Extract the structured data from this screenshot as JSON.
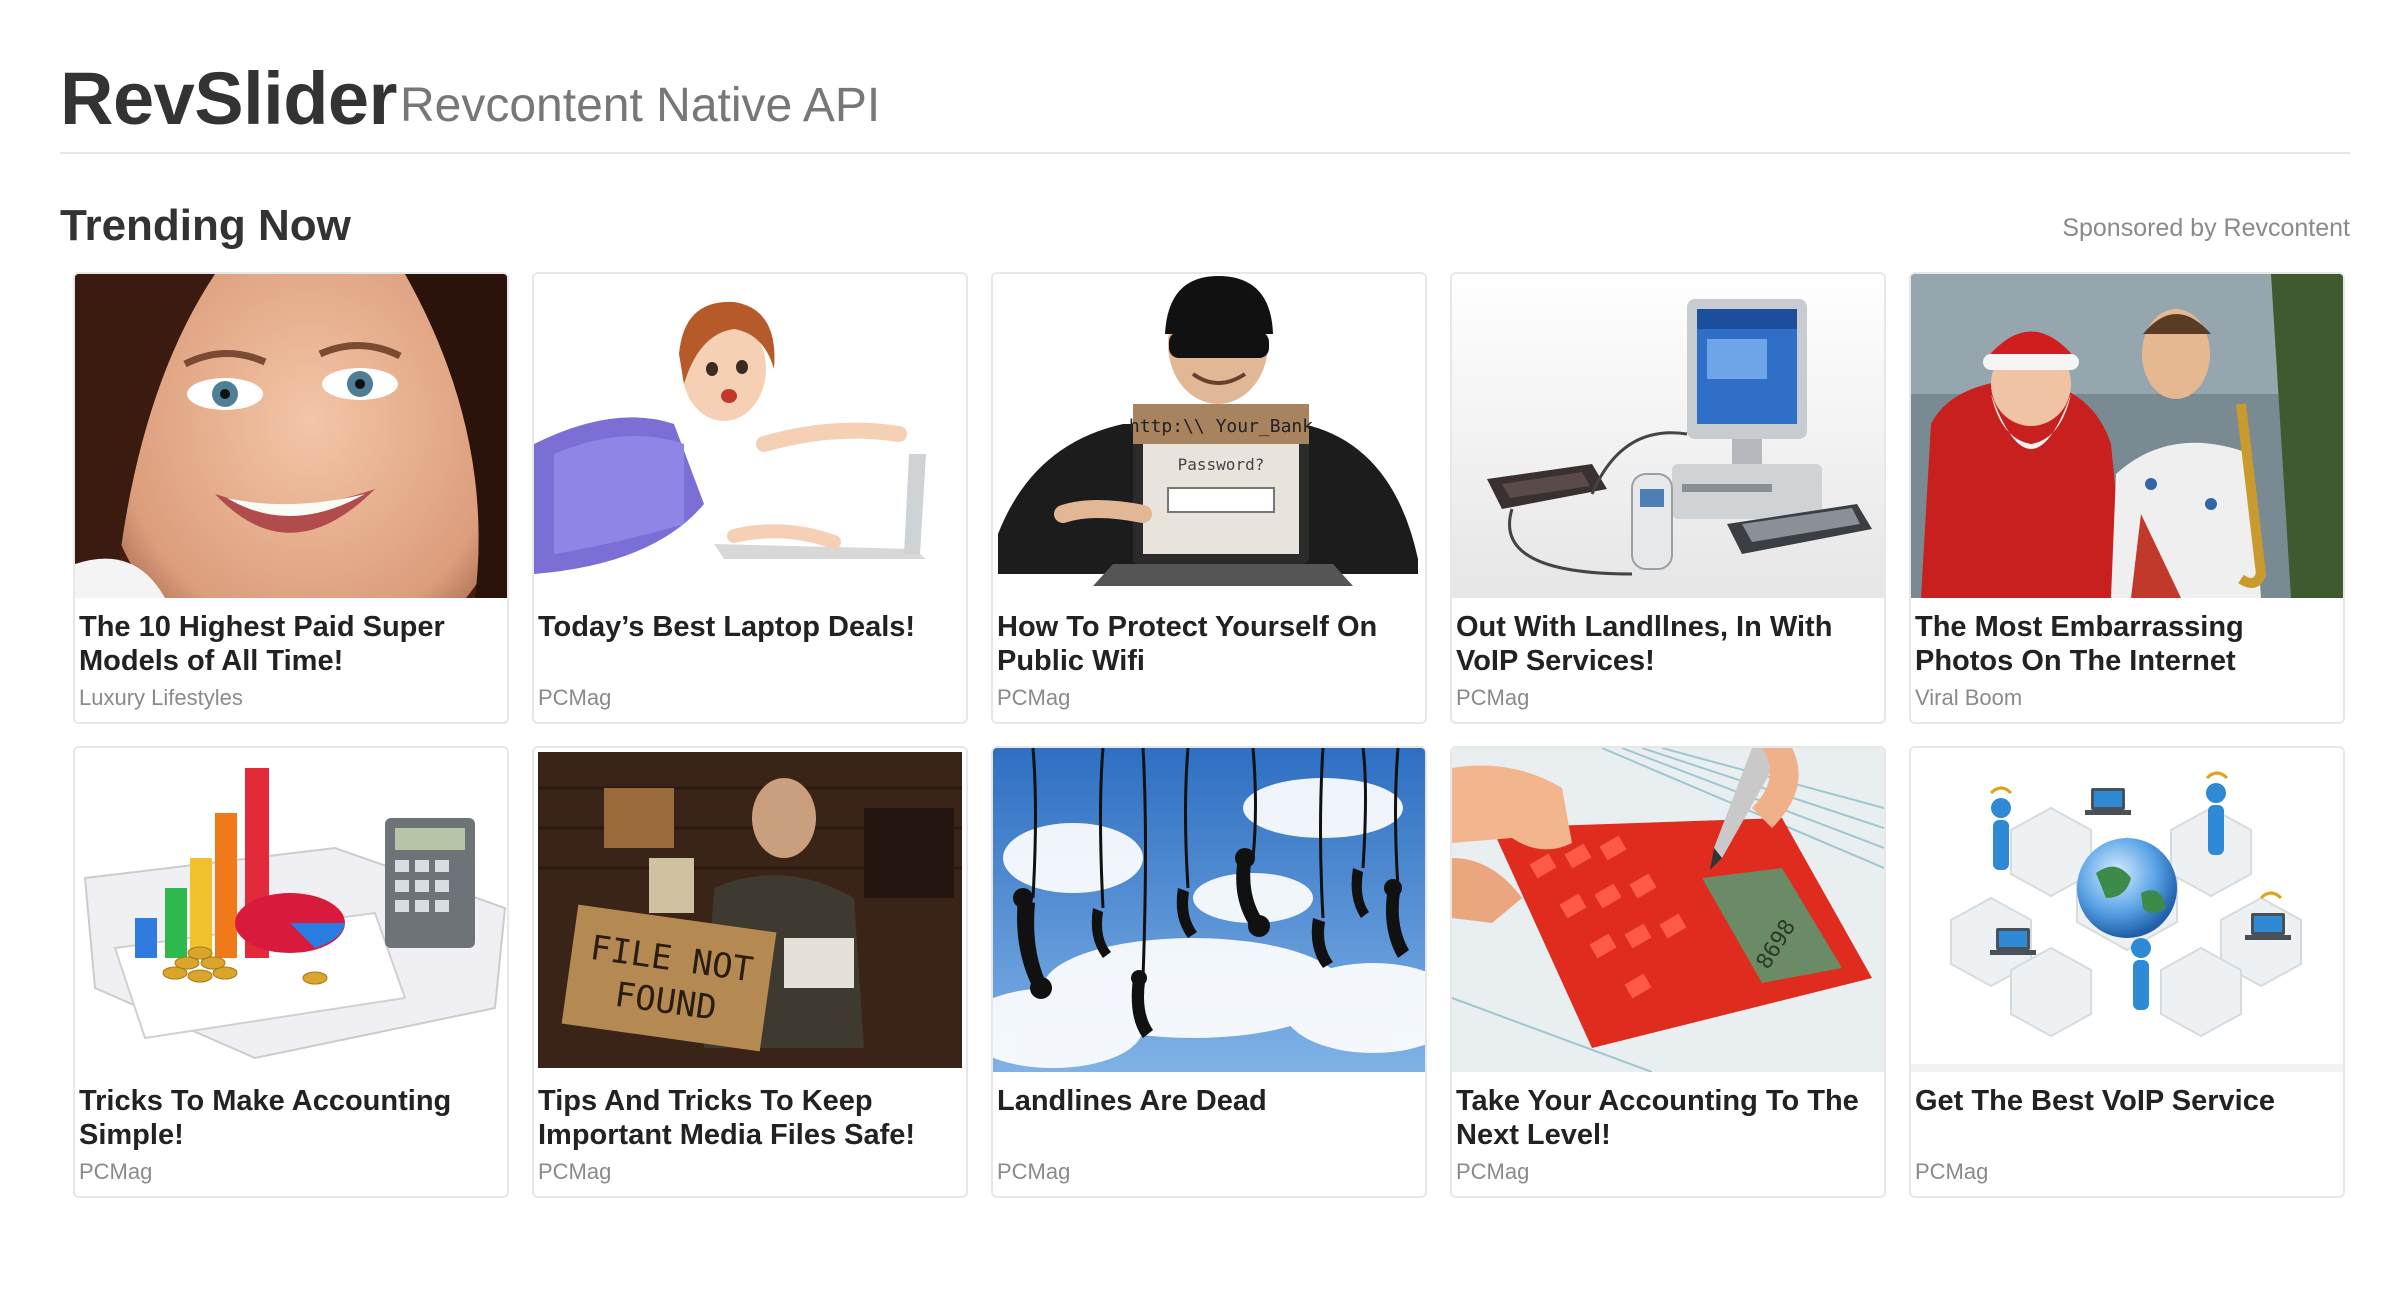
{
  "header": {
    "brand": "RevSlider",
    "subtitle": "Revcontent Native API"
  },
  "section": {
    "title": "Trending Now",
    "sponsor_label": "Sponsored by Revcontent"
  },
  "cards": [
    {
      "headline": "The 10 Highest Paid Super Models of All Time!",
      "provider": "Luxury Lifestyles",
      "image": "smiling-model-portrait"
    },
    {
      "headline": "Today’s Best Laptop Deals!",
      "provider": "PCMag",
      "image": "woman-pointing-at-laptop"
    },
    {
      "headline": "How To Protect Yourself On Public Wifi",
      "provider": "PCMag",
      "image": "masked-thief-with-laptop",
      "image_text": {
        "screen_top": "http:\\\\ Your_Bank",
        "screen_prompt": "Password?"
      }
    },
    {
      "headline": "Out With Landllnes, In With VoIP Services!",
      "provider": "PCMag",
      "image": "desktop-computer-phone-router"
    },
    {
      "headline": "The Most Embarrassing Photos On The Internet",
      "provider": "Viral Boom",
      "image": "santa-with-saxophonist"
    },
    {
      "headline": "Tricks To Make Accounting Simple!",
      "provider": "PCMag",
      "image": "charts-coins-calculator"
    },
    {
      "headline": "Tips And Tricks To Keep Important Media Files Safe!",
      "provider": "PCMag",
      "image": "man-with-file-not-found-sign",
      "image_text": {
        "sign_line1": "FILE NOT",
        "sign_line2": "FOUND"
      }
    },
    {
      "headline": "Landlines Are Dead",
      "provider": "PCMag",
      "image": "hanging-phone-receivers-sky"
    },
    {
      "headline": "Take Your Accounting To The Next Level!",
      "provider": "PCMag",
      "image": "red-calculator-with-pen",
      "image_text": {
        "display": "8698"
      }
    },
    {
      "headline": "Get The Best VoIP Service",
      "provider": "PCMag",
      "image": "network-globe-people"
    }
  ],
  "colors": {
    "title": "#333333",
    "muted": "#777777",
    "provider": "#8a8a8a",
    "card_border": "#e7e7e7",
    "calculator_red": "#e02b1f"
  }
}
